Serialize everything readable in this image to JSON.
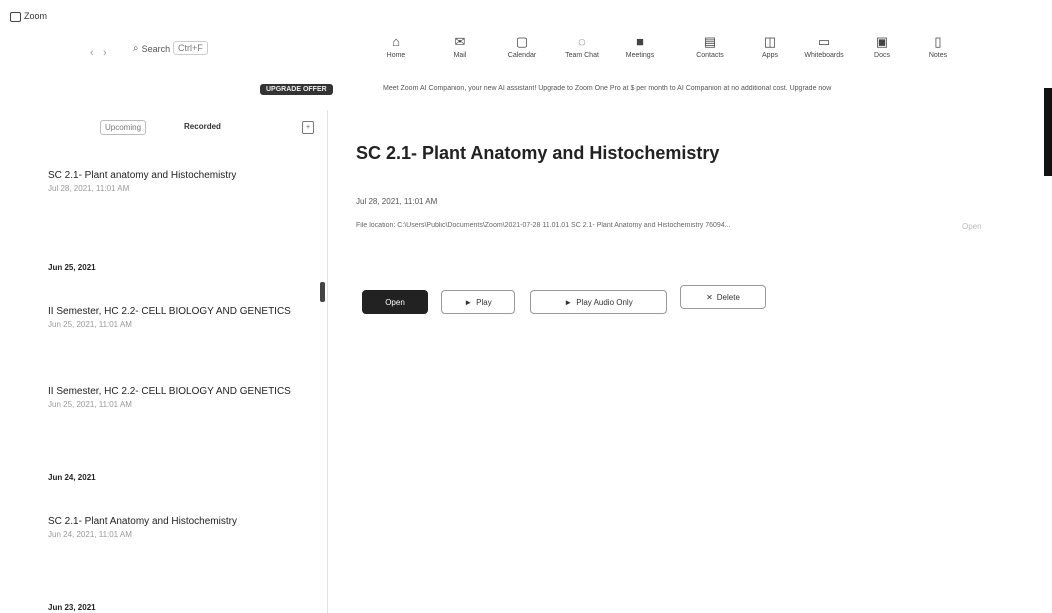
{
  "app": {
    "title": "Zoom"
  },
  "header": {
    "search_label": "Search",
    "search_shortcut": "Ctrl+F",
    "toolbar_items": [
      {
        "label": "Home",
        "icon": "home-icon",
        "glyph": "⌂"
      },
      {
        "label": "Mail",
        "icon": "mail-icon",
        "glyph": "✉"
      },
      {
        "label": "Calendar",
        "icon": "calendar-icon",
        "glyph": "▢"
      },
      {
        "label": "Team Chat",
        "icon": "chat-icon",
        "glyph": "◌"
      },
      {
        "label": "Meetings",
        "icon": "video-icon",
        "glyph": "■"
      },
      {
        "label": "Contacts",
        "icon": "contacts-icon",
        "glyph": "▤"
      },
      {
        "label": "Apps",
        "icon": "apps-icon",
        "glyph": "◫"
      },
      {
        "label": "Whiteboards",
        "icon": "whiteboard-icon",
        "glyph": "▭"
      },
      {
        "label": "Docs",
        "icon": "docs-icon",
        "glyph": "▣"
      },
      {
        "label": "Notes",
        "icon": "notes-icon",
        "glyph": "▯"
      }
    ]
  },
  "banner": {
    "badge": "UPGRADE OFFER",
    "text": "Meet Zoom AI Companion, your new AI assistant! Upgrade to Zoom One Pro at $ per month to AI Companion at no additional cost. Upgrade now"
  },
  "sidebar": {
    "tabs": [
      "Upcoming",
      "Recorded"
    ],
    "filter_icon": "filter-icon",
    "recordings": [
      {
        "title": "SC 2.1- Plant anatomy and Histochemistry",
        "time": "Jul 28, 2021, 11:01 AM"
      },
      {
        "date_header": "Jun 25, 2021"
      },
      {
        "title": "II Semester, HC 2.2- CELL BIOLOGY AND GENETICS",
        "time": "Jun 25, 2021, 11:01 AM"
      },
      {
        "title": "II Semester, HC 2.2- CELL BIOLOGY AND GENETICS",
        "time": "Jun 25, 2021, 11:01 AM"
      },
      {
        "date_header": "Jun 24, 2021"
      },
      {
        "title": "SC 2.1- Plant Anatomy and Histochemistry",
        "time": "Jun 24, 2021, 11:01 AM"
      },
      {
        "date_header": "Jun 23, 2021"
      }
    ]
  },
  "main": {
    "title": "SC 2.1- Plant Anatomy and Histochemistry",
    "date": "Jul 28, 2021, 11:01 AM",
    "location": "File location: C:\\Users\\Public\\Documents\\Zoom\\2021-07-28 11.01.01 SC 2.1- Plant Anatomy and Histochemistry 76094...",
    "open_location": "Open",
    "buttons": {
      "open": "Open",
      "play": "Play",
      "play_audio": "Play Audio Only",
      "delete": "Delete"
    }
  }
}
